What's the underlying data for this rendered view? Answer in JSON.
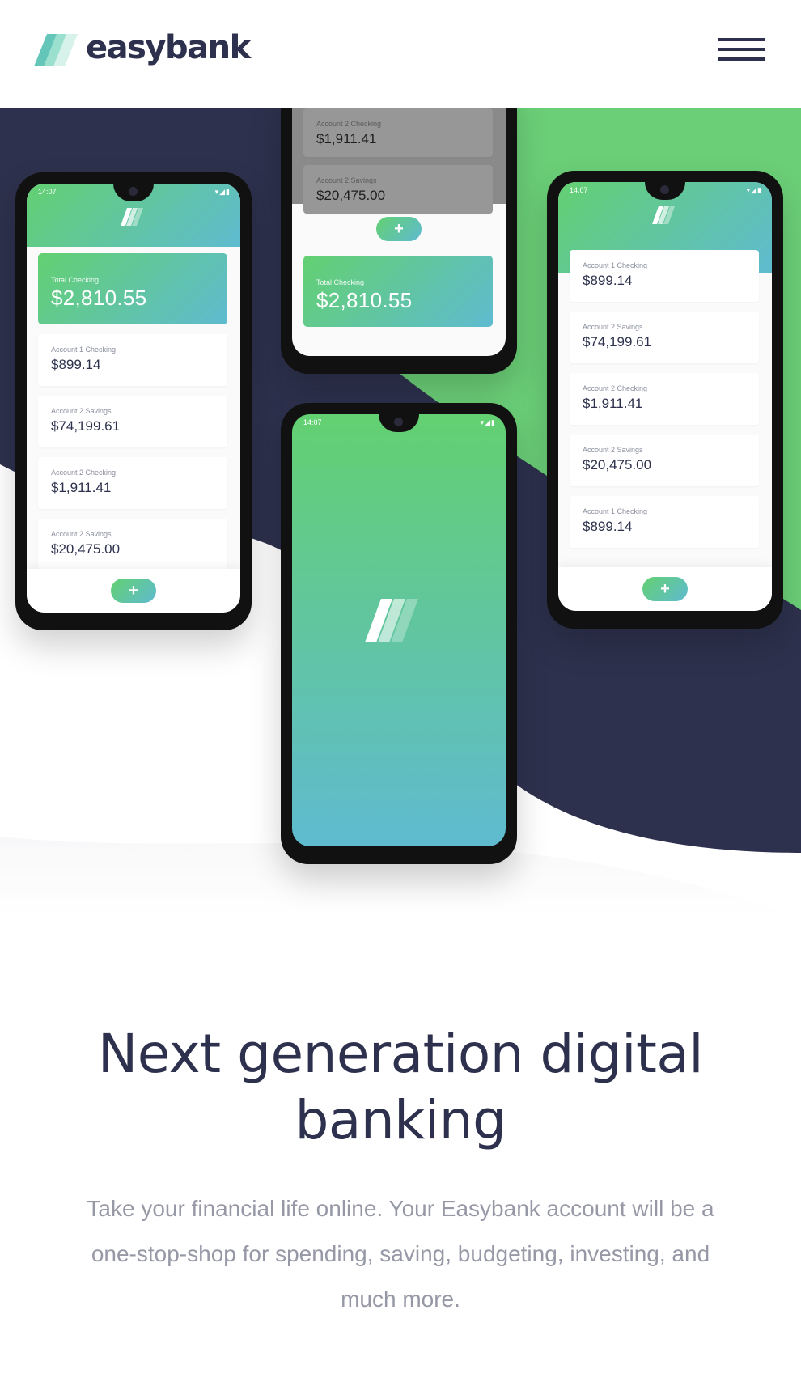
{
  "header": {
    "logo_text": "easybank",
    "logo_icon": "easybank-logo-icon",
    "menu_icon": "hamburger-icon"
  },
  "colors": {
    "dark_blue": "#2d314d",
    "lime_green": "#31d35c",
    "bright_cyan": "#2bb7da",
    "grayish_blue": "#9698a6"
  },
  "phones": {
    "left": {
      "time": "14:07",
      "total": {
        "label": "Total Checking",
        "amount": "$2,810.55"
      },
      "accounts": [
        {
          "label": "Account 1 Checking",
          "amount": "$899.14"
        },
        {
          "label": "Account 2 Savings",
          "amount": "$74,199.61"
        },
        {
          "label": "Account 2 Checking",
          "amount": "$1,911.41"
        },
        {
          "label": "Account 2 Savings",
          "amount": "$20,475.00"
        }
      ],
      "add_label": "+"
    },
    "top_center": {
      "accounts": [
        {
          "label": "Account 2 Checking",
          "amount": "$1,911.41"
        },
        {
          "label": "Account 2 Savings",
          "amount": "$20,475.00"
        }
      ],
      "total": {
        "label": "Total Checking",
        "amount": "$2,810.55"
      },
      "add_label": "+"
    },
    "center": {
      "time": "14:07"
    },
    "right": {
      "time": "14:07",
      "accounts": [
        {
          "label": "Account 1 Checking",
          "amount": "$899.14"
        },
        {
          "label": "Account 2 Savings",
          "amount": "$74,199.61"
        },
        {
          "label": "Account 2 Checking",
          "amount": "$1,911.41"
        },
        {
          "label": "Account 2 Savings",
          "amount": "$20,475.00"
        },
        {
          "label": "Account 1 Checking",
          "amount": "$899.14"
        }
      ],
      "add_label": "+"
    }
  },
  "intro": {
    "title": "Next generation digital banking",
    "description": "Take your financial life online. Your Easybank account will be a one-stop-shop for spending, saving, budgeting, investing, and much more."
  }
}
